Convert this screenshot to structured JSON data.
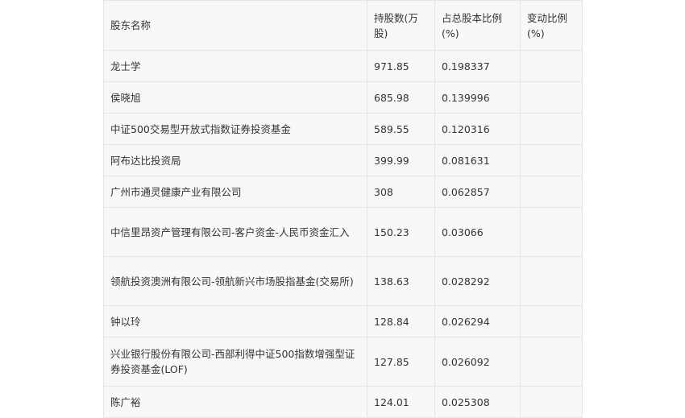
{
  "table": {
    "headers": [
      "股东名称",
      "持股数(万股)",
      "占总股本比例(%)",
      "变动比例(%)"
    ],
    "rows": [
      [
        "龙士学",
        "971.85",
        "0.198337",
        ""
      ],
      [
        "侯晓旭",
        "685.98",
        "0.139996",
        ""
      ],
      [
        "中证500交易型开放式指数证券投资基金",
        "589.55",
        "0.120316",
        ""
      ],
      [
        "阿布达比投资局",
        "399.99",
        "0.081631",
        ""
      ],
      [
        "广州市通灵健康产业有限公司",
        "308",
        "0.062857",
        ""
      ],
      [
        "中信里昂资产管理有限公司-客户资金-人民币资金汇入",
        "150.23",
        "0.03066",
        ""
      ],
      [
        "领航投资澳洲有限公司-领航新兴市场股指基金(交易所)",
        "138.63",
        "0.028292",
        ""
      ],
      [
        "钟以玲",
        "128.84",
        "0.026294",
        ""
      ],
      [
        "兴业银行股份有限公司-西部利得中证500指数增强型证券投资基金(LOF)",
        "127.85",
        "0.026092",
        ""
      ],
      [
        "陈广裕",
        "124.01",
        "0.025308",
        ""
      ]
    ]
  }
}
